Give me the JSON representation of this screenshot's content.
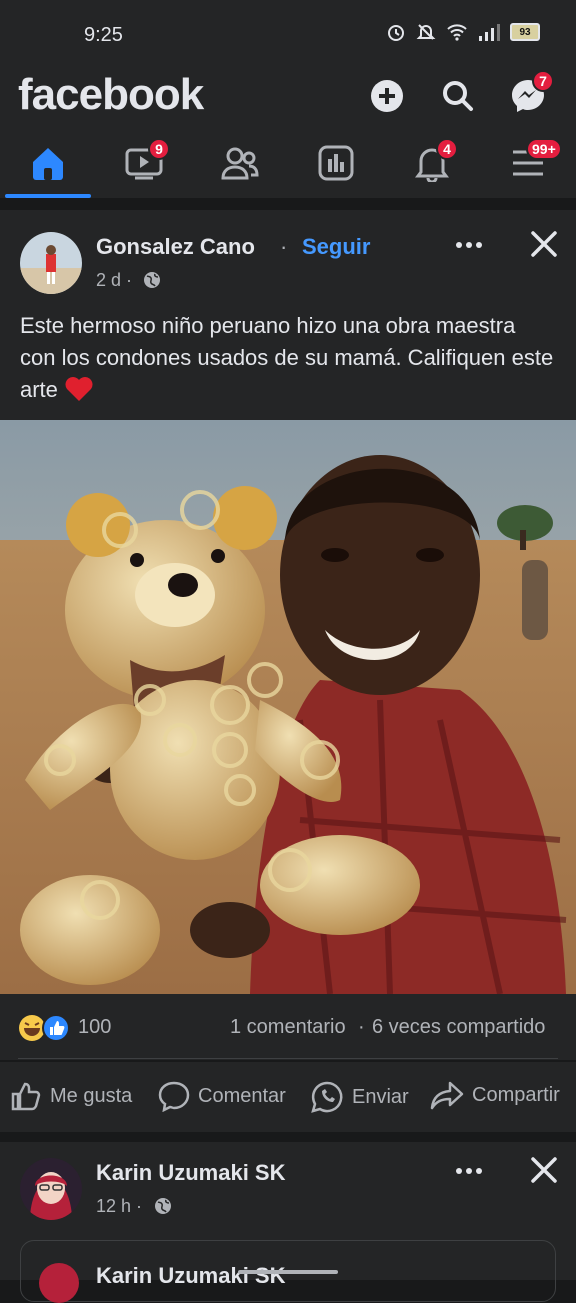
{
  "status_bar": {
    "time": "9:25",
    "battery": "93"
  },
  "header": {
    "logo": "facebook",
    "messenger_badge": "7"
  },
  "tabs": [
    {
      "name": "home",
      "icon": "home-icon",
      "badge": ""
    },
    {
      "name": "watch",
      "icon": "video-icon",
      "badge": "9"
    },
    {
      "name": "friends",
      "icon": "friends-icon",
      "badge": ""
    },
    {
      "name": "feeds",
      "icon": "feeds-icon",
      "badge": ""
    },
    {
      "name": "notifications",
      "icon": "bell-icon",
      "badge": "4"
    },
    {
      "name": "menu",
      "icon": "menu-icon",
      "badge": "99+"
    }
  ],
  "post": {
    "author": "Gonsalez Cano",
    "separator": "·",
    "follow": "Seguir",
    "time": "2 d ·",
    "text": "Este hermoso niño peruano hizo una obra maestra con los condones usados de su mamá. Califiquen este arte",
    "reaction_count": "100",
    "comments": "1 comentario",
    "shares": "6 veces compartido",
    "actions": [
      "Me gusta",
      "Comentar",
      "Enviar",
      "Compartir"
    ]
  },
  "post2": {
    "author": "Karin Uzumaki SK",
    "time": "12 h ·",
    "shared_author": "Karin Uzumaki SK"
  },
  "colors": {
    "accent": "#2d88ff",
    "follow": "#4599ff",
    "badge": "#e41e3f",
    "background": "#18191a",
    "card": "#242526"
  }
}
